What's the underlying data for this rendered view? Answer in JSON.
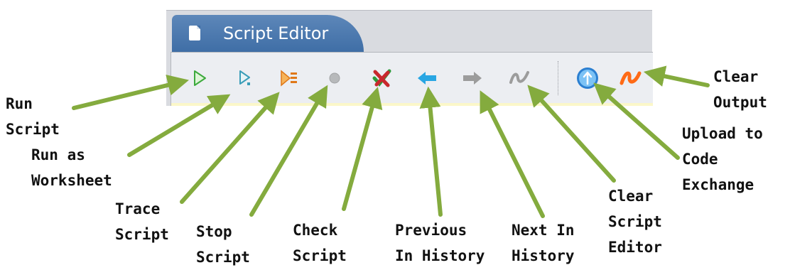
{
  "window": {
    "tab_title": "Script Editor"
  },
  "toolbar": {
    "buttons": [
      {
        "id": "run",
        "icon": "play-icon",
        "color": "#3daa3d"
      },
      {
        "id": "run-worksheet",
        "icon": "play-worksheet-icon",
        "color": "#3a9db8"
      },
      {
        "id": "trace",
        "icon": "trace-icon",
        "color": "#f08a22"
      },
      {
        "id": "stop",
        "icon": "stop-icon",
        "color": "#a9abad"
      },
      {
        "id": "check",
        "icon": "check-icon",
        "color": "#c8282d"
      },
      {
        "id": "previous",
        "icon": "arrow-left-icon",
        "color": "#29a6e3"
      },
      {
        "id": "next",
        "icon": "arrow-right-icon",
        "color": "#9c9c9c"
      },
      {
        "id": "clear-editor",
        "icon": "squiggle-icon",
        "color": "#9c9c9c"
      },
      {
        "id": "upload",
        "icon": "upload-icon",
        "color": "#2b7fd1"
      },
      {
        "id": "clear-output",
        "icon": "squiggle-icon",
        "color": "#ff6a16"
      }
    ]
  },
  "annotations": {
    "run_script": [
      "Run",
      "Script"
    ],
    "run_as_worksheet": [
      "Run as",
      "Worksheet"
    ],
    "trace_script": [
      "Trace",
      "Script"
    ],
    "stop_script": [
      "Stop",
      "Script"
    ],
    "check_script": [
      "Check",
      "Script"
    ],
    "previous_in_history": [
      "Previous",
      "In History"
    ],
    "next_in_history": [
      "Next In",
      "History"
    ],
    "clear_script_editor": [
      "Clear",
      "Script",
      "Editor"
    ],
    "upload_to_code_exchange": [
      "Upload to",
      "Code",
      "Exchange"
    ],
    "clear_output": [
      "Clear",
      "Output"
    ]
  },
  "colors": {
    "tab": "#3f6ea6",
    "arrow": "#84ab3e",
    "toolbar_bg": "#eceef2"
  }
}
